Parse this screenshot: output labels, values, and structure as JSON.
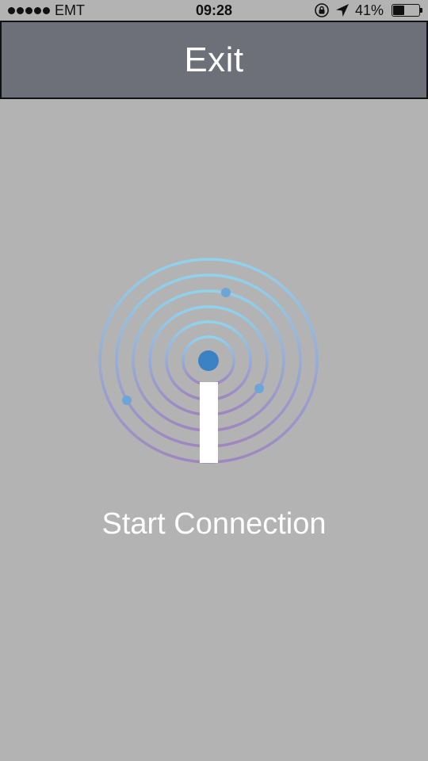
{
  "status_bar": {
    "carrier": "EMT",
    "time": "09:28",
    "battery_percent": "41%",
    "battery_level": 0.41
  },
  "header": {
    "exit_label": "Exit"
  },
  "main": {
    "connection_label": "Start Connection"
  },
  "colors": {
    "background": "#b3b3b3",
    "header": "#6d7078",
    "ring_top": "#8fd3ee",
    "ring_bottom": "#9e86c0",
    "center_dot": "#3b82c4",
    "orbit_dot": "#6aa7d8"
  }
}
